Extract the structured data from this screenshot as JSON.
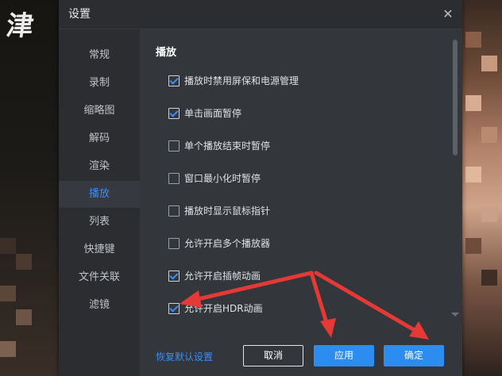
{
  "window": {
    "title": "设置",
    "close_glyph": "✕"
  },
  "sidebar": {
    "items": [
      {
        "label": "常规",
        "active": false
      },
      {
        "label": "录制",
        "active": false
      },
      {
        "label": "缩略图",
        "active": false
      },
      {
        "label": "解码",
        "active": false
      },
      {
        "label": "渲染",
        "active": false
      },
      {
        "label": "播放",
        "active": true
      },
      {
        "label": "列表",
        "active": false
      },
      {
        "label": "快捷键",
        "active": false
      },
      {
        "label": "文件关联",
        "active": false
      },
      {
        "label": "滤镜",
        "active": false
      }
    ]
  },
  "content": {
    "section_title": "播放",
    "options": [
      {
        "label": "播放时禁用屏保和电源管理",
        "checked": true
      },
      {
        "label": "单击画面暂停",
        "checked": true
      },
      {
        "label": "单个播放结束时暂停",
        "checked": false
      },
      {
        "label": "窗口最小化时暂停",
        "checked": false
      },
      {
        "label": "播放时显示鼠标指针",
        "checked": false
      },
      {
        "label": "允许开启多个播放器",
        "checked": false
      },
      {
        "label": "允许开启插帧动画",
        "checked": true
      },
      {
        "label": "允许开启HDR动画",
        "checked": true
      }
    ]
  },
  "footer": {
    "restore_label": "恢复默认设置",
    "cancel_label": "取消",
    "apply_label": "应用",
    "ok_label": "确定"
  },
  "background": {
    "calligraphy_text": "津"
  },
  "colors": {
    "accent": "#3d8cf2",
    "button_primary": "#2d8cf0",
    "dialog_bg": "#2b2d31",
    "content_bg": "#33363b",
    "annotation_arrow": "#e53935"
  }
}
